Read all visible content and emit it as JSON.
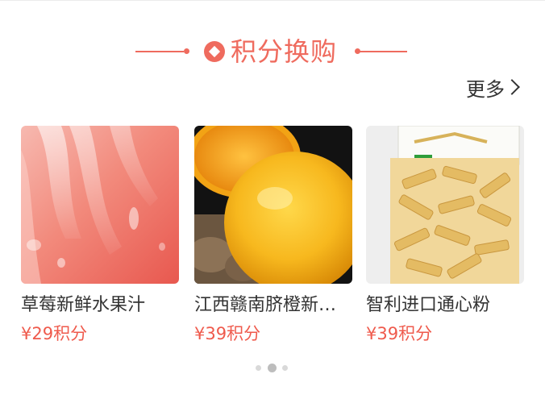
{
  "section": {
    "title": "积分换购",
    "more_label": "更多",
    "accent_color": "#ef6b5e"
  },
  "products": [
    {
      "name": "草莓新鲜水果汁",
      "price": "¥29积分",
      "image": "strawberry-juice-closeup"
    },
    {
      "name": "江西赣南脐橙新鲜...",
      "price": "¥39积分",
      "image": "navel-orange"
    },
    {
      "name": "智利进口通心粉",
      "price": "¥39积分",
      "image": "penne-pasta-bag"
    }
  ],
  "pagination": {
    "pages": 3,
    "current": 2
  }
}
